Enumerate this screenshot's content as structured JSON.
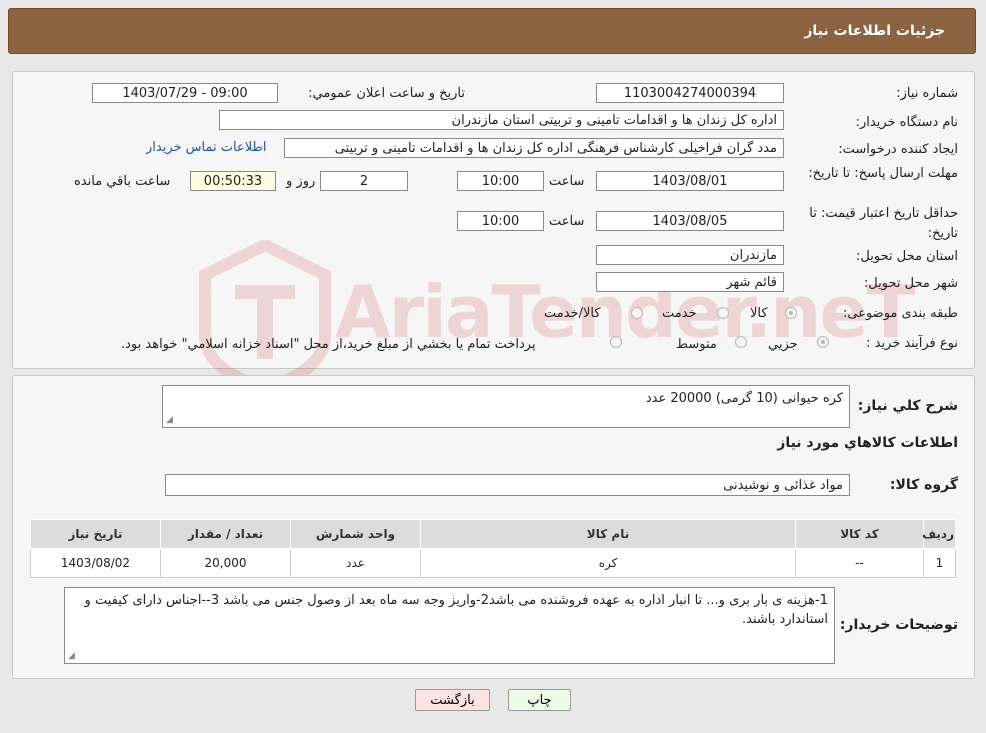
{
  "header": {
    "title": "جزئیات اطلاعات نیاز"
  },
  "need": {
    "number_label": "شماره نیاز:",
    "number": "1103004274000394",
    "announce_label": "تاریخ و ساعت اعلان عمومي:",
    "announce": "1403/07/29 - 09:00",
    "buyer_org_label": "نام دستگاه خريدار:",
    "buyer_org": "اداره کل زندان ها و اقدامات تامینی و تربیتی استان مازندران",
    "creator_label": "ايجاد کننده درخواست:",
    "creator": "مدد گران فراخیلی کارشناس فرهنگی اداره کل زندان ها و اقدامات تامینی و تربیتی",
    "contact_link": "اطلاعات تماس خريدار",
    "reply_deadline_label": "مهلت ارسال پاسخ: تا تاریخ:",
    "reply_date": "1403/08/01",
    "time_label": "ساعت",
    "reply_time": "10:00",
    "days": "2",
    "days_label": "روز و",
    "remaining": "00:50:33",
    "remaining_label": "ساعت باقي مانده",
    "validity_label": "حداقل تاريخ اعتبار قيمت: تا تاریخ:",
    "validity_date": "1403/08/05",
    "validity_time": "10:00",
    "province_label": "استان محل تحويل:",
    "province": "مازندران",
    "city_label": "شهر محل تحويل:",
    "city": "قائم شهر",
    "category_label": "طبقه بندی موضوعی:",
    "category_options": [
      "کالا",
      "خدمت",
      "کالا/خدمت"
    ],
    "process_label": "نوع فرآيند خريد :",
    "process_options": [
      "جزيي",
      "متوسط"
    ],
    "process_note": "پرداخت تمام يا بخشي از مبلغ خريد،از محل \"اسناد خزانه اسلامي\" خواهد بود."
  },
  "details": {
    "desc_label": "شرح کلي نياز:",
    "desc": "کره حیوانی (10 گرمی) 20000 عدد",
    "goods_title": "اطلاعات کالاهاي مورد نياز",
    "group_label": "گروه کالا:",
    "group": "مواد غذائی و نوشیدنی",
    "table": {
      "headers": [
        "رديف",
        "کد کالا",
        "نام کالا",
        "واحد شمارش",
        "تعداد / مقدار",
        "تاریخ نیاز"
      ],
      "rows": [
        [
          "1",
          "--",
          "کره",
          "عدد",
          "20,000",
          "1403/08/02"
        ]
      ]
    },
    "buyer_notes_label": "توضيحات خريدار:",
    "buyer_notes": "1-هزینه ی بار بری و... تا انبار اداره به عهده فروشنده می باشد2-واریز وجه سه ماه بعد از وصول جنس می باشد 3--اجناس دارای کیفیت و استاندارد باشند."
  },
  "buttons": {
    "print": "چاپ",
    "back": "بازگشت"
  },
  "watermark": {
    "text": "AriaTender.neT"
  },
  "colors": {
    "header": "#8b6340",
    "print_btn": "#eafbe6",
    "back_btn": "#fbe3e3",
    "link": "#1a57b8"
  }
}
